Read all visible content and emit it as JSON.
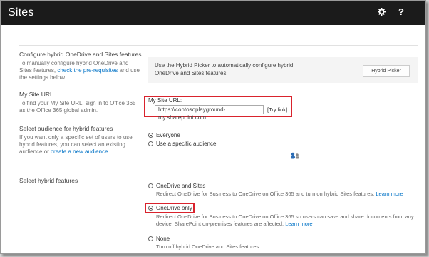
{
  "header": {
    "title": "Sites",
    "settings_icon": "gear-icon",
    "help_icon": "question-mark-icon",
    "help_glyph": "?"
  },
  "configure": {
    "heading": "Configure hybrid OneDrive and Sites features",
    "text": "To manually configure hybrid OneDrive and Sites features, ",
    "link": "check the pre-requisites",
    "text_after": " and use the settings below",
    "info_text": "Use the Hybrid Picker to automatically configure hybrid OneDrive and Sites features.",
    "button_label": "Hybrid Picker"
  },
  "mysite": {
    "heading": "My Site URL",
    "text": "To find your My Site URL, sign in to Office 365 as the Office 365 global admin.",
    "field_label": "My Site URL:",
    "url_value": "https://contosoplayground-my.sharepoint.com",
    "try_link": "[Try link]"
  },
  "audience": {
    "heading": "Select audience for hybrid features",
    "text": "If you want only a specific set of users to use hybrid features, you can select an existing audience or ",
    "link": "create a new audience",
    "options": [
      "Everyone",
      "Use a specific audience:"
    ],
    "audience_value": "",
    "browse_icon": "people-picker-icon"
  },
  "features": {
    "heading": "Select hybrid features",
    "options": [
      {
        "label": "OneDrive and Sites",
        "desc": "Redirect OneDrive for Business to OneDrive on Office 365 and turn on hybrid Sites features.",
        "link": "Learn more"
      },
      {
        "label": "OneDrive only",
        "desc": "Redirect OneDrive for Business to OneDrive on Office 365 so users can save and share documents from any device. SharePoint on-premises features are affected.",
        "link": "Learn more"
      },
      {
        "label": "None",
        "desc": "Turn off hybrid OneDrive and Sites features.",
        "link": ""
      }
    ],
    "selected": "OneDrive only"
  },
  "colors": {
    "topbar": "#1b1b1b",
    "link": "#0072c6",
    "highlight": "#d9232d"
  }
}
